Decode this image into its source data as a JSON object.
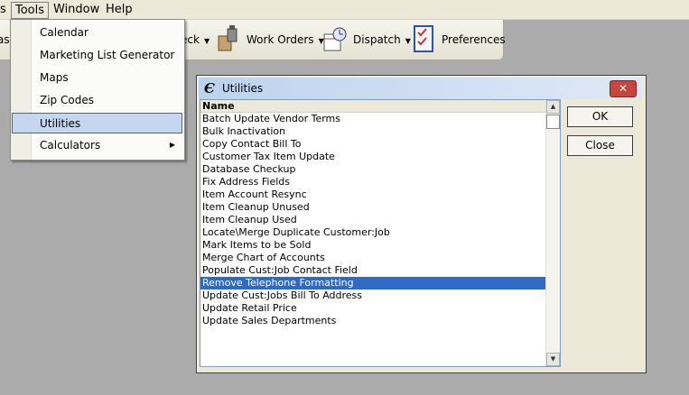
{
  "menubar": {
    "items": [
      {
        "label": "s"
      },
      {
        "label": "Tools"
      },
      {
        "label": "Window"
      },
      {
        "label": "Help"
      }
    ]
  },
  "toolbar": {
    "left_fragment": "as",
    "check_label": "eck",
    "work_orders_label": "Work Orders",
    "dispatch_label": "Dispatch",
    "preferences_label": "Preferences"
  },
  "tools_menu": {
    "items": [
      {
        "label": "Calendar"
      },
      {
        "label": "Marketing List Generator"
      },
      {
        "label": "Maps"
      },
      {
        "label": "Zip Codes"
      },
      {
        "label": "Utilities",
        "selected": true
      },
      {
        "label": "Calculators",
        "submenu": true
      }
    ]
  },
  "dialog": {
    "title": "Utilities",
    "close_symbol": "✕",
    "column_header": "Name",
    "items": [
      "Batch Update Vendor Terms",
      "Bulk Inactivation",
      "Copy Contact Bill To",
      "Customer Tax Item Update",
      "Database Checkup",
      "Fix Address Fields",
      "Item Account Resync",
      "Item Cleanup Unused",
      "Item Cleanup Used",
      "Locate\\Merge Duplicate Customer:Job",
      "Mark Items to be Sold",
      "Merge Chart of Accounts",
      "Populate Cust:Job Contact Field",
      "Remove Telephone Formatting",
      "Update Cust:Jobs Bill To Address",
      "Update Retail Price",
      "Update Sales Departments"
    ],
    "selected_item": "Remove Telephone Formatting",
    "ok_label": "OK",
    "close_label": "Close"
  },
  "colors": {
    "selection": "#316ac5",
    "menu_highlight": "#c4d6f0",
    "background": "#ababab"
  }
}
